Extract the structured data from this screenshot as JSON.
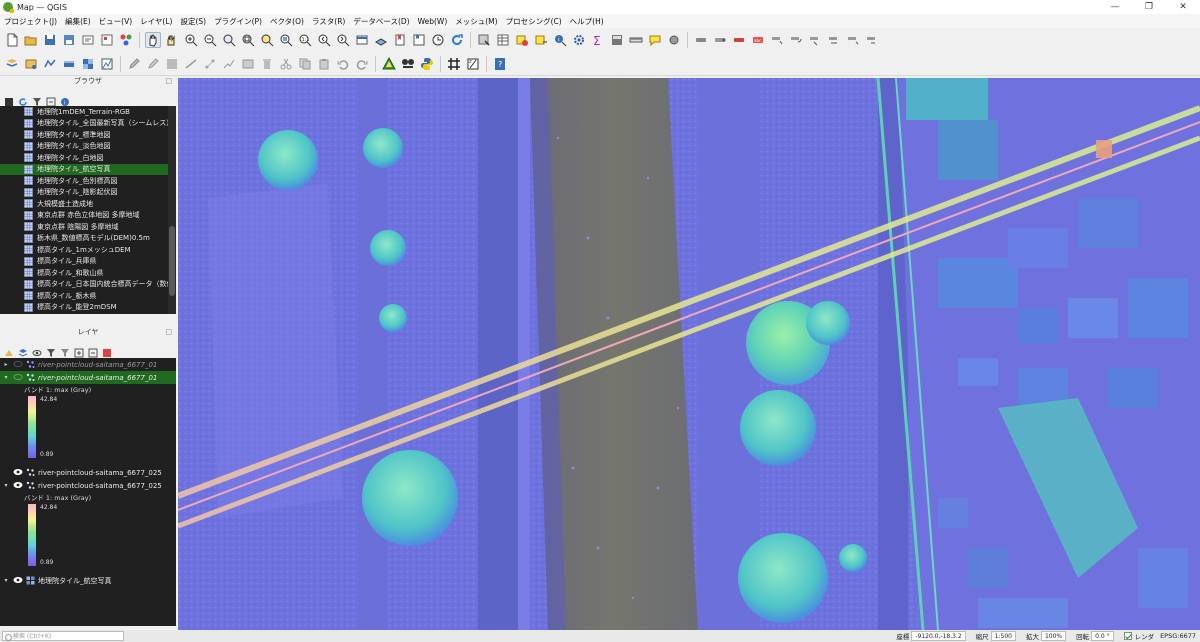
{
  "window": {
    "title": "Map — QGIS",
    "controls": [
      "—",
      "❐",
      "✕"
    ]
  },
  "menu": [
    "プロジェクト(J)",
    "編集(E)",
    "ビュー(V)",
    "レイヤ(L)",
    "設定(S)",
    "プラグイン(P)",
    "ベクタ(O)",
    "ラスタ(R)",
    "データベース(D)",
    "Web(W)",
    "メッシュ(M)",
    "プロセシング(C)",
    "ヘルプ(H)"
  ],
  "browser_panel": {
    "title": "ブラウザ",
    "items": [
      "地理院1mDEM_Terrain-RGB",
      "地理院タイル_全国最新写真（シームレス）",
      "地理院タイル_標準地図",
      "地理院タイル_淡色地図",
      "地理院タイル_白地図",
      "地理院タイル_航空写真",
      "地理院タイル_色別標高図",
      "地理院タイル_陰影起伏図",
      "大規模盛土造成地",
      "東京点群 赤色立体地図 多摩地域",
      "東京点群 陰陽図 多摩地域",
      "栃木県_数値標高モデル(DEM)0.5m",
      "標高タイル_1mメッシュDEM",
      "標高タイル_兵庫県",
      "標高タイル_和歌山県",
      "標高タイル_日本国内統合標高データ（数値",
      "標高タイル_栃木県",
      "標高タイル_能登2mDSM"
    ],
    "selected_index": 5
  },
  "layers_panel": {
    "title": "レイヤ",
    "layers": [
      {
        "name": "river-pointcloud-saitama_6677_01",
        "style": "dim",
        "visible": false
      },
      {
        "name": "river-pointcloud-saitama_6677_01",
        "style": "selected",
        "visible": false
      },
      {
        "name": "river-pointcloud-saitama_6677_025",
        "style": "normal",
        "visible": true
      },
      {
        "name": "river-pointcloud-saitama_6677_025",
        "style": "normal",
        "visible": true
      },
      {
        "name": "地理院タイル_航空写真",
        "style": "normal",
        "visible": true
      }
    ],
    "legend": {
      "band_label": "バンド 1: max (Gray)",
      "max": "42.84",
      "min": "0.89"
    }
  },
  "statusbar": {
    "locator_placeholder": "検索 (Ctrl+K)",
    "coordinate_label": "座標",
    "coordinate_value": "-9120.0,-18.3.2",
    "scale_label": "縮尺",
    "scale_value": "1:500",
    "magnifier_label": "拡大",
    "magnifier_value": "100%",
    "rotation_label": "回転",
    "rotation_value": "0.0 °",
    "render_label": "レンダ",
    "crs": "EPSG:6677"
  },
  "colors": {
    "map_base": "#6f72dd",
    "selection_green": "#1f6a1f",
    "panel_dark": "#202020"
  }
}
